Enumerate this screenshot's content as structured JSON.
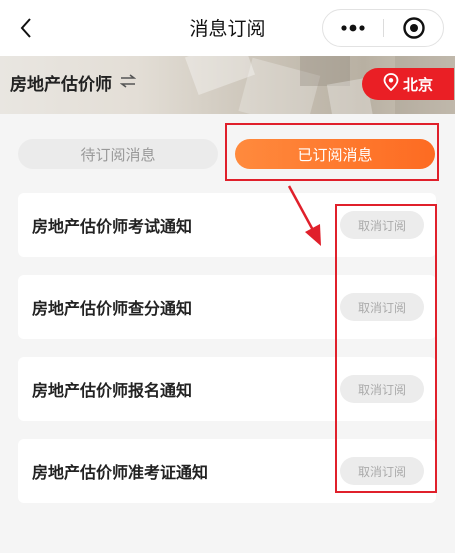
{
  "navbar": {
    "title": "消息订阅",
    "back_icon": "chevron-left-icon",
    "more_icon": "more-dots-icon",
    "close_icon": "target-close-icon"
  },
  "banner": {
    "exam_name": "房地产估价师",
    "switch_icon": "swap-arrows-icon",
    "city": "北京",
    "city_icon": "location-pin-icon",
    "city_color": "#ea1f25"
  },
  "tabs": [
    {
      "label": "待订阅消息",
      "active": false
    },
    {
      "label": "已订阅消息",
      "active": true
    }
  ],
  "tab_active_color": "#fd6b22",
  "subscriptions": [
    {
      "title": "房地产估价师考试通知",
      "action": "取消订阅"
    },
    {
      "title": "房地产估价师查分通知",
      "action": "取消订阅"
    },
    {
      "title": "房地产估价师报名通知",
      "action": "取消订阅"
    },
    {
      "title": "房地产估价师准考证通知",
      "action": "取消订阅"
    }
  ],
  "annotation_color": "#e0202b"
}
